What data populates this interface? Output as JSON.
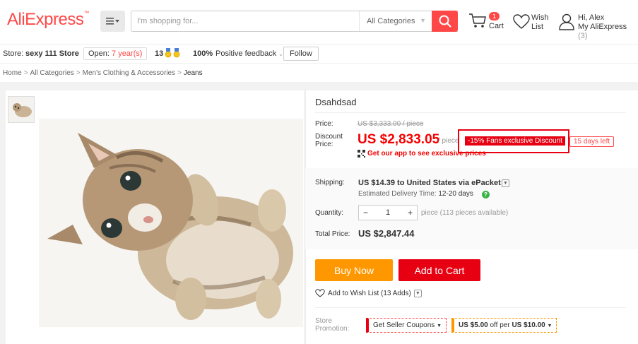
{
  "header": {
    "logo": "AliExpress",
    "search_placeholder": "I'm shopping for...",
    "category_select": "All Categories",
    "cart_count": "1",
    "cart_label": "Cart",
    "wish_label_1": "Wish",
    "wish_label_2": "List",
    "user_greeting": "Hi, Alex",
    "user_account": "My AliExpress",
    "user_count": "(3)"
  },
  "store": {
    "label": "Store:",
    "name": "sexy 111 Store",
    "open_prefix": "Open:",
    "open_years": "7 year(s)",
    "level": "13",
    "feedback_pct": "100%",
    "feedback_label": "Positive feedback",
    "follow": "Follow"
  },
  "breadcrumb": [
    "Home",
    "All Categories",
    "Men's Clothing & Accessories",
    "Jeans"
  ],
  "product": {
    "title": "Dsahdsad",
    "price_label": "Price:",
    "original_price": "US $3,333.00 / piece",
    "discount_label_1": "Discount",
    "discount_label_2": "Price:",
    "discount_price": "US $2,833.05",
    "per_piece": "/ piece",
    "fans_discount": "-15% Fans exclusive Discount",
    "days_left": "15 days left",
    "app_promo": "Get our app to see exclusive prices"
  },
  "shipping": {
    "label": "Shipping:",
    "value": "US $14.39 to United States via ePacket",
    "eta_label": "Estimated Delivery Time:",
    "eta_value": "12-20 days"
  },
  "quantity": {
    "label": "Quantity:",
    "value": "1",
    "available": "piece (113 pieces available)"
  },
  "total": {
    "label": "Total Price:",
    "value": "US $2,847.44"
  },
  "actions": {
    "buy_now": "Buy Now",
    "add_to_cart": "Add to Cart",
    "add_wishlist": "Add to Wish List (13 Adds)"
  },
  "promotion": {
    "label_1": "Store",
    "label_2": "Promotion:",
    "coupon": "Get Seller Coupons",
    "deal_amount": "US $5.00",
    "deal_mid": "off per",
    "deal_threshold": "US $10.00"
  },
  "colors": {
    "brand_red": "#ff4747",
    "price_red": "#f40000",
    "buy_orange": "#ff9700",
    "cart_red": "#e60012"
  }
}
